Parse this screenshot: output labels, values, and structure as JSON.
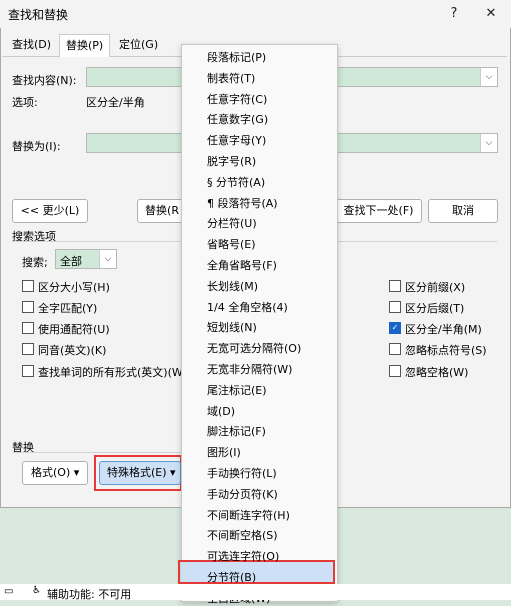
{
  "window": {
    "title": "查找和替换",
    "help_label": "?",
    "close_label": "✕"
  },
  "tabs": [
    {
      "label": "查找(D)"
    },
    {
      "label": "替换(P)"
    },
    {
      "label": "定位(G)"
    }
  ],
  "find": {
    "label": "查找内容(N):",
    "value": ""
  },
  "options": {
    "label": "选项:",
    "value": "区分全/半角"
  },
  "replace": {
    "label": "替换为(I):",
    "value": ""
  },
  "buttons": {
    "less": "<< 更少(L)",
    "replace": "替换(R",
    "find_next": "查找下一处(F)",
    "cancel": "取消",
    "format": "格式(O)",
    "special": "特殊格式(E)"
  },
  "search_options": {
    "heading": "搜索选项",
    "search_label": "搜索;",
    "search_value": "全部",
    "left": [
      {
        "label": "区分大小写(H)",
        "checked": false
      },
      {
        "label": "全字匹配(Y)",
        "checked": false
      },
      {
        "label": "使用通配符(U)",
        "checked": false
      },
      {
        "label": "同音(英文)(K)",
        "checked": false
      },
      {
        "label": "查找单词的所有形式(英文)(W",
        "checked": false
      }
    ],
    "right": [
      {
        "label": "区分前缀(X)",
        "checked": false
      },
      {
        "label": "区分后缀(T)",
        "checked": false
      },
      {
        "label": "区分全/半角(M)",
        "checked": true
      },
      {
        "label": "忽略标点符号(S)",
        "checked": false
      },
      {
        "label": "忽略空格(W)",
        "checked": false
      }
    ]
  },
  "replace_section": {
    "heading": "替换"
  },
  "menu_items": [
    "段落标记(P)",
    "制表符(T)",
    "任意字符(C)",
    "任意数字(G)",
    "任意字母(Y)",
    "脱字号(R)",
    "§ 分节符(A)",
    "¶ 段落符号(A)",
    "分栏符(U)",
    "省略号(E)",
    "全角省略号(F)",
    "长划线(M)",
    "1/4 全角空格(4)",
    "短划线(N)",
    "无宽可选分隔符(O)",
    "无宽非分隔符(W)",
    "尾注标记(E)",
    "域(D)",
    "脚注标记(F)",
    "图形(I)",
    "手动换行符(L)",
    "手动分页符(K)",
    "不间断连字符(H)",
    "不间断空格(S)",
    "可选连字符(O)",
    "分节符(B)",
    "空白区域(W)"
  ],
  "highlighted_item": "分节符(B)",
  "status": {
    "label": "辅助功能: 不可用"
  },
  "colors": {
    "highlight_border": "#e53935",
    "checkbox_accent": "#1a64c8",
    "combo_fill": "#cfe8d8"
  }
}
